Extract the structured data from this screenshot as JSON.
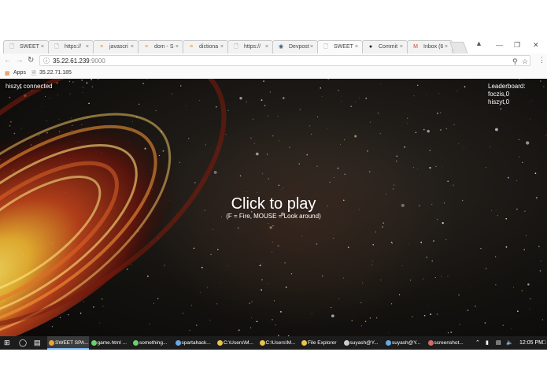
{
  "browser": {
    "tabs": [
      {
        "title": "SWEET",
        "icon": "page-icon"
      },
      {
        "title": "https://",
        "icon": "page-icon"
      },
      {
        "title": "javascri",
        "icon": "mdn-icon"
      },
      {
        "title": "dom - S",
        "icon": "stackoverflow-icon"
      },
      {
        "title": "dictiona",
        "icon": "stackoverflow-icon"
      },
      {
        "title": "https://",
        "icon": "page-icon"
      },
      {
        "title": "Devpost",
        "icon": "devpost-icon"
      },
      {
        "title": "SWEET",
        "icon": "page-icon",
        "active": true
      },
      {
        "title": "Commit",
        "icon": "github-icon"
      },
      {
        "title": "Inbox (6",
        "icon": "gmail-icon"
      }
    ],
    "url_host": "35.22.61.239",
    "url_port": ":9000",
    "bookmarks": {
      "apps": "Apps",
      "item": "35.22.71.185"
    }
  },
  "game": {
    "status": "hiszyt connected",
    "leaderboard_title": "Leaderboard:",
    "leaderboard": [
      "foczis,0",
      "hiszyt,0"
    ],
    "play_title": "Click to play",
    "play_hint": "(F = Fire, MOUSE = Look around)"
  },
  "taskbar": {
    "items": [
      {
        "label": "SWEET SPA...",
        "color": "#e8a33a",
        "active": true
      },
      {
        "label": "game.html ...",
        "color": "#6fcf6f"
      },
      {
        "label": "something...",
        "color": "#6fcf6f"
      },
      {
        "label": "spartahack...",
        "color": "#6aa9e0"
      },
      {
        "label": "C:\\Users\\M...",
        "color": "#e8c44a"
      },
      {
        "label": "C:\\Users\\M...",
        "color": "#e8c44a"
      },
      {
        "label": "File Explorer",
        "color": "#e8c44a"
      },
      {
        "label": "suyash@Y...",
        "color": "#cccccc"
      },
      {
        "label": "suyash@Y...",
        "color": "#6aa9e0"
      },
      {
        "label": "screenshot...",
        "color": "#d46a6a"
      }
    ],
    "clock": "12:05 PM"
  }
}
